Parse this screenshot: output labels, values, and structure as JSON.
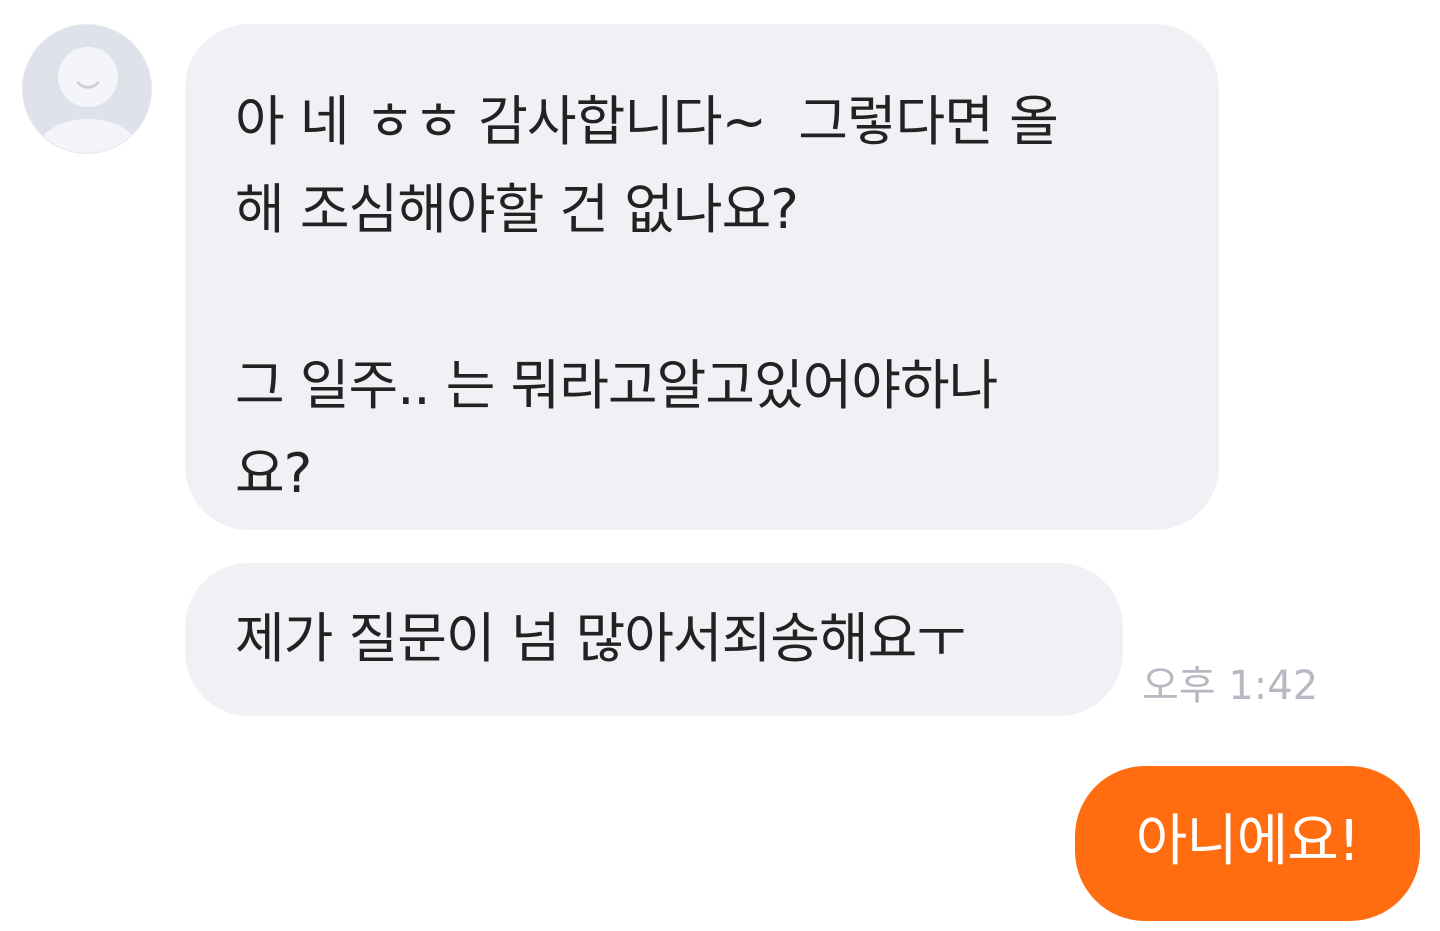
{
  "conversation": {
    "messages": [
      {
        "sender": "other",
        "text": "아 네 ㅎㅎ 감사합니다~  그렇다면 올\n해 조심해야할 건 없나요?\n\n그 일주.. 는 뭐라고알고있어야하나\n요?"
      },
      {
        "sender": "other",
        "text": "제가 질문이 넘 많아서죄송해요ㅜ",
        "time": "오후 1:42"
      },
      {
        "sender": "me",
        "text": "아니에요!"
      }
    ]
  },
  "avatar": {
    "icon": "default-user-avatar-icon"
  },
  "colors": {
    "incoming_bubble": "#f0f1f5",
    "outgoing_bubble": "#ff6d10",
    "timestamp": "#b6b9c1",
    "text": "#222222"
  }
}
